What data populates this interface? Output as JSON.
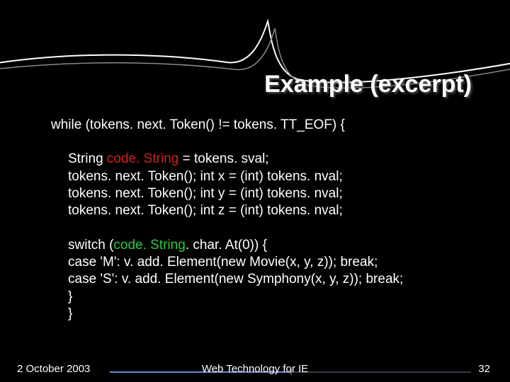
{
  "title": "Example (excerpt)",
  "code": {
    "while": "while (tokens. next. Token() != tokens. TT_EOF) {",
    "l1a": "String ",
    "l1b": "code. String",
    "l1c": " = tokens. sval;",
    "l2": "tokens. next. Token(); int x = (int) tokens. nval;",
    "l3": "tokens. next. Token(); int y = (int) tokens. nval;",
    "l4": "tokens. next. Token(); int z = (int) tokens. nval;",
    "s1a": "switch (",
    "s1b": "code. String",
    "s1c": ". char. At(0)) {",
    "c1": "  case 'M': v. add. Element(new Movie(x, y, z)); break;",
    "c2": "  case 'S': v. add. Element(new Symphony(x, y, z)); break;",
    "close1": "}",
    "close2": "}"
  },
  "footer": {
    "date": "2 October 2003",
    "center": "Web Technology for IE",
    "page": "32"
  }
}
